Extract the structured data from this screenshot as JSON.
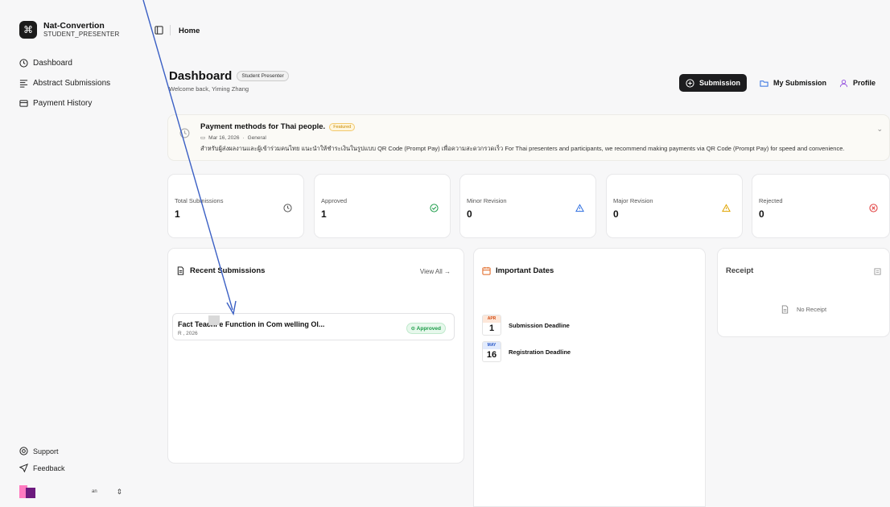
{
  "brand": {
    "name": "Nat-Convertion",
    "role": "STUDENT_PRESENTER",
    "logo_glyph": "⌘"
  },
  "sidebar": {
    "items": [
      {
        "label": "Dashboard",
        "icon": "clock-icon"
      },
      {
        "label": "Abstract Submissions",
        "icon": "list-icon"
      },
      {
        "label": "Payment History",
        "icon": "credit-card-icon"
      }
    ],
    "footer": [
      {
        "label": "Support",
        "icon": "lifebuoy-icon"
      },
      {
        "label": "Feedback",
        "icon": "send-icon"
      }
    ],
    "user": {
      "name": "an"
    }
  },
  "breadcrumb": {
    "current": "Home"
  },
  "header": {
    "title": "Dashboard",
    "role_badge": "Student Presenter",
    "welcome": "Welcome back, Yiming Zhang"
  },
  "actions": {
    "submission": "Submission",
    "my_submission": "My Submission",
    "profile": "Profile"
  },
  "announcement": {
    "title": "Payment methods for Thai people.",
    "badge": "Featured",
    "date": "Mar 16, 2026",
    "category": "General",
    "text": "สำหรับผู้ส่งผลงานและผู้เข้าร่วมคนไทย แนะนำให้ชำระเงินในรูปแบบ QR Code (Prompt Pay) เพื่อความสะดวกรวดเร็ว For Thai presenters and participants, we recommend making payments via QR Code (Prompt Pay) for speed and convenience."
  },
  "stats": [
    {
      "label": "Total Submissions",
      "value": "1",
      "icon": "clock-icon",
      "color": "#555555"
    },
    {
      "label": "Approved",
      "value": "1",
      "icon": "check-circle-icon",
      "color": "#1a9b47"
    },
    {
      "label": "Minor Revision",
      "value": "0",
      "icon": "warning-icon",
      "color": "#2f6fe0"
    },
    {
      "label": "Major Revision",
      "value": "0",
      "icon": "warning-icon",
      "color": "#e0a400"
    },
    {
      "label": "Rejected",
      "value": "0",
      "icon": "x-circle-icon",
      "color": "#e03a3a"
    }
  ],
  "recent": {
    "title": "Recent Submissions",
    "view_all": "View All →",
    "items": [
      {
        "title": "Fact          Teachi          e Function in Com          welling Ol...",
        "date": "R           , 2026",
        "status": "Approved"
      }
    ]
  },
  "dates": {
    "title": "Important Dates",
    "items": [
      {
        "month": "APR",
        "day": "1",
        "label": "Submission Deadline"
      },
      {
        "month": "MAY",
        "day": "16",
        "label": "Registration Deadline"
      }
    ]
  },
  "receipt": {
    "title": "Receipt",
    "empty": "No Receipt"
  }
}
